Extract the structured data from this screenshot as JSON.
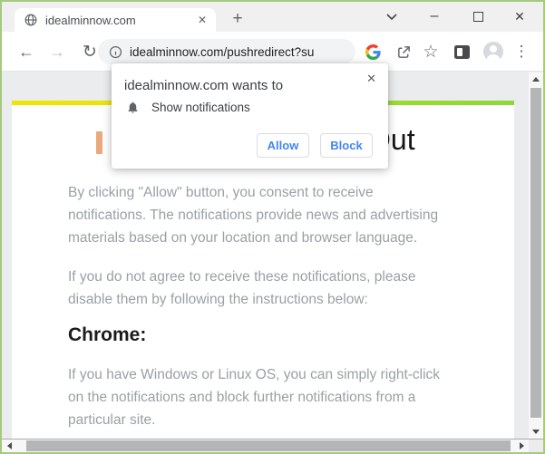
{
  "tab_strip": {
    "tab_title": "idealminnow.com",
    "tab_close_glyph": "✕",
    "new_tab_label": "+"
  },
  "window_controls": {
    "minimize_label": "–",
    "close_label": "✕"
  },
  "navbar": {
    "back_glyph": "←",
    "forward_glyph": "→",
    "reload_glyph": "↻",
    "url": "idealminnow.com/pushredirect?su",
    "star_glyph": "☆",
    "menu_glyph": "⋮"
  },
  "permission_dialog": {
    "close_glyph": "✕",
    "title": "idealminnow.com wants to",
    "permission_label": "Show notifications",
    "allow_label": "Allow",
    "block_label": "Block"
  },
  "page": {
    "heading_fragment": "Out",
    "paragraph1_lines": [
      "By clicking \"Allow\" button, you consent to receive",
      "notifications. The notifications provide news and advertising",
      "materials based on your location and browser language."
    ],
    "paragraph2_lines": [
      "If you do not agree to receive these notifications, please",
      "disable them by following the instructions below:"
    ],
    "section_heading": "Chrome:",
    "paragraph3_lines": [
      "If you have Windows or Linux OS, you can simply right-click",
      "on the notifications and block further notifications from a",
      "particular site."
    ]
  },
  "colors": {
    "window_border": "#a6ca7d",
    "progress_gradient_start": "#ece600",
    "progress_gradient_end": "#8ed936",
    "dialog_button_text": "#4285f4",
    "body_text": "#9aa0a6",
    "heading_text": "#161616"
  }
}
